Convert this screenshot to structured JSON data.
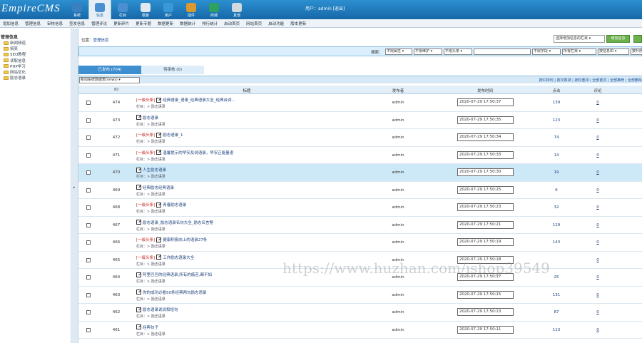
{
  "app": {
    "logo": "EmpireCMS",
    "user_info": "用户：admin [退出]"
  },
  "top_nav": [
    {
      "label": "系统",
      "color": "#3a7fc0"
    },
    {
      "label": "信息",
      "color": "#4a90d0",
      "active": true
    },
    {
      "label": "栏目",
      "color": "#4a90d0"
    },
    {
      "label": "模板",
      "color": "#e0e8f0"
    },
    {
      "label": "用户",
      "color": "#3a98d8"
    },
    {
      "label": "插件",
      "color": "#d89a30"
    },
    {
      "label": "商城",
      "color": "#30a060"
    },
    {
      "label": "其他",
      "color": "#d0d8e0"
    }
  ],
  "menu": [
    "增加信息",
    "管理信息",
    "审核信息",
    "签发信息",
    "管理评论",
    "更新碎片",
    "更新专题",
    "数据更新",
    "数据统计",
    "排行统计",
    "启动首页",
    "网站首页",
    "启动功能",
    "版本更新"
  ],
  "sidebar": {
    "root": "管理信息",
    "items": [
      "新闻频道",
      "搞笑",
      "SEO教程",
      "读取信息",
      "PHP学习",
      "网站优化",
      "励志语录"
    ]
  },
  "location": {
    "label": "位置：",
    "link": "管理信息"
  },
  "column_select": "选择增加信息的栏目 ▾",
  "add_button": "增加信息",
  "search": {
    "label": "搜索：",
    "filters": [
      "不限属性 ▾",
      "不限维护 ▾",
      "不限头条 ▾",
      "",
      "不限字段 ▾",
      "所有栏目 ▾",
      "按信息ID ▾",
      "按升序 ▾"
    ]
  },
  "tabs": {
    "published": "已发布 (704)",
    "pending": "待审核 (0)"
  },
  "toolbar": {
    "model_select": "新闻系统数据表(news) ▾",
    "links": "按ID排列 | 按次数排 | 按权重排 | 全部置顶 | 全部推荐 | 全部删除"
  },
  "columns": {
    "id": "ID",
    "title": "标题",
    "publisher": "发布者",
    "time": "发布时间",
    "clicks": "点击",
    "comments": "评论"
  },
  "rows": [
    {
      "id": "474",
      "tag": "[一级头条]",
      "title": "经典语录_语录_经典语录大全_经典台词...",
      "column": "栏目：> 励志语录",
      "author": "admin",
      "time": "2020-07-29 17:50:37",
      "clicks": "139",
      "comments": "0"
    },
    {
      "id": "473",
      "tag": "",
      "title": "励志语录",
      "column": "栏目：> 励志语录",
      "author": "admin",
      "time": "2020-07-29 17:50:35",
      "clicks": "123",
      "comments": "0"
    },
    {
      "id": "472",
      "tag": "[一级头条]",
      "title": "励志语录_1",
      "column": "栏目：> 励志语录",
      "author": "admin",
      "time": "2020-07-29 17:50:34",
      "clicks": "74",
      "comments": "0"
    },
    {
      "id": "471",
      "tag": "[一级头条]",
      "title": "温馨提示的早安及说语录，早安正能量语",
      "column": "栏目：> 励志语录",
      "author": "admin",
      "time": "2020-07-29 17:50:33",
      "clicks": "14",
      "comments": "0"
    },
    {
      "id": "470",
      "tag": "",
      "title": "人生励志语录",
      "column": "栏目：> 励志语录",
      "author": "admin",
      "time": "2020-07-29 17:50:30",
      "clicks": "19",
      "comments": "0",
      "highlight": true
    },
    {
      "id": "469",
      "tag": "",
      "title": "经典励志经典语录",
      "column": "栏目：> 励志语录",
      "author": "admin",
      "time": "2020-07-29 17:50:25",
      "clicks": "6",
      "comments": "0"
    },
    {
      "id": "468",
      "tag": "[一级头条]",
      "title": "青春励志语录",
      "column": "栏目：> 励志语录",
      "author": "admin",
      "time": "2020-07-29 17:50:23",
      "clicks": "32",
      "comments": "0"
    },
    {
      "id": "467",
      "tag": "",
      "title": "励志语录_励志语录名句大全_励志名言警",
      "column": "栏目：> 励志语录",
      "author": "admin",
      "time": "2020-07-29 17:50:21",
      "clicks": "129",
      "comments": "0"
    },
    {
      "id": "466",
      "tag": "[一级头条]",
      "title": "健康积极向上的语录27条",
      "column": "栏目：> 励志语录",
      "author": "admin",
      "time": "2020-07-29 17:50:19",
      "clicks": "143",
      "comments": "0"
    },
    {
      "id": "465",
      "tag": "[一级头条]",
      "title": "工作励志语录大全",
      "column": "栏目：> 励志语录",
      "author": "admin",
      "time": "2020-07-29 17:50:18",
      "clicks": "",
      "comments": "0"
    },
    {
      "id": "464",
      "tag": "",
      "title": "阿里巴巴的经典语录,所有的痛苦,都不如",
      "column": "栏目：> 励志语录",
      "author": "admin",
      "time": "2020-07-29 17:50:17",
      "clicks": "25",
      "comments": "0"
    },
    {
      "id": "463",
      "tag": "",
      "title": "你的成功必看50条经典两句励志语录",
      "column": "栏目：> 励志语录",
      "author": "admin",
      "time": "2020-07-29 17:50:15",
      "clicks": "131",
      "comments": "0"
    },
    {
      "id": "462",
      "tag": "",
      "title": "励志语录说说和短句",
      "column": "栏目：> 励志语录",
      "author": "admin",
      "time": "2020-07-29 17:50:13",
      "clicks": "87",
      "comments": "0"
    },
    {
      "id": "461",
      "tag": "",
      "title": "经典句子",
      "column": "栏目：> 励志语录",
      "author": "admin",
      "time": "2020-07-29 17:50:11",
      "clicks": "113",
      "comments": "0"
    }
  ],
  "watermark": "https://www.huzhan.com/ishop39549"
}
